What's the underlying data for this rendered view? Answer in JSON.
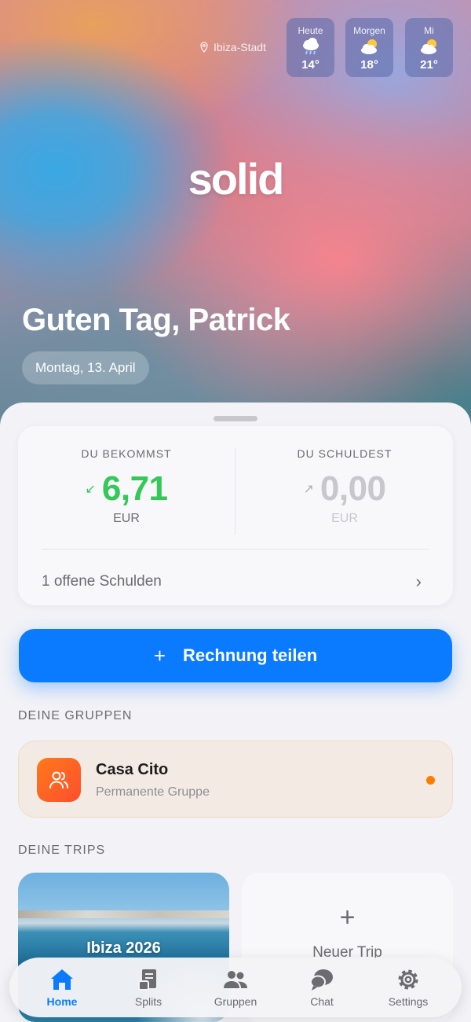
{
  "hero": {
    "location": "Ibiza-Stadt",
    "weather": [
      {
        "day": "Heute",
        "temp": "14°",
        "icon": "rain-cloud-icon"
      },
      {
        "day": "Morgen",
        "temp": "18°",
        "icon": "partly-sunny-icon"
      },
      {
        "day": "Mi",
        "temp": "21°",
        "icon": "partly-sunny-icon"
      }
    ],
    "logo": "solid",
    "greeting": "Guten Tag, Patrick",
    "date": "Montag, 13. April"
  },
  "balance": {
    "receive_label": "DU BEKOMMST",
    "receive_amount": "6,71",
    "receive_currency": "EUR",
    "owe_label": "DU SCHULDEST",
    "owe_amount": "0,00",
    "owe_currency": "EUR",
    "open_debts": "1 offene Schulden",
    "colors": {
      "receive": "#34c759",
      "owe": "#c7c7cc"
    }
  },
  "split_button": {
    "label": "Rechnung teilen"
  },
  "groups": {
    "title": "DEINE GRUPPEN",
    "items": [
      {
        "name": "Casa Cito",
        "subtitle": "Permanente Gruppe",
        "icon": "people-icon"
      }
    ]
  },
  "trips": {
    "title": "DEINE TRIPS",
    "items": [
      {
        "name": "Ibiza 2026"
      }
    ],
    "new_label": "Neuer Trip"
  },
  "tab_bar": {
    "tabs": [
      {
        "label": "Home",
        "icon": "home-icon",
        "active": true
      },
      {
        "label": "Splits",
        "icon": "receipt-icon",
        "active": false
      },
      {
        "label": "Gruppen",
        "icon": "people-icon",
        "active": false
      },
      {
        "label": "Chat",
        "icon": "chat-bubble-icon",
        "active": false
      },
      {
        "label": "Settings",
        "icon": "gear-icon",
        "active": false
      }
    ],
    "accent": "#0a7aff"
  }
}
